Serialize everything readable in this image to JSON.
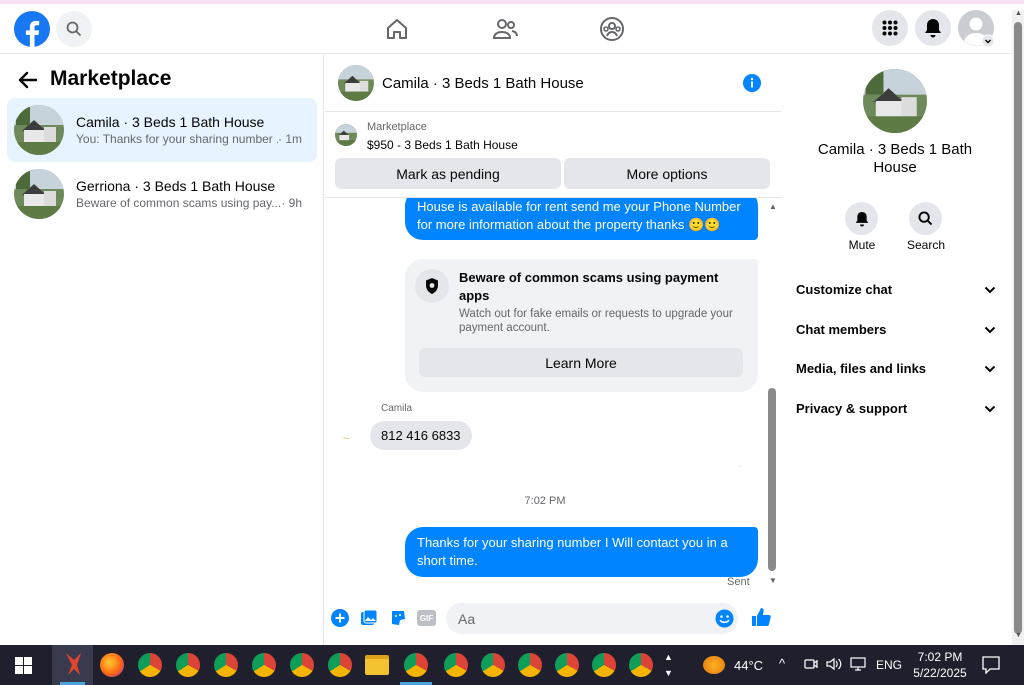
{
  "window": {
    "title": "Marketplace"
  },
  "topnav": {
    "home_icon": "home-icon",
    "friends_icon": "friends-icon",
    "groups_icon": "groups-icon"
  },
  "left": {
    "title": "Marketplace",
    "conversations": [
      {
        "name": "Camila · 3 Beds 1 Bath House",
        "preview": "You: Thanks for your sharing number ...",
        "time": "· 1m"
      },
      {
        "name": "Gerriona · 3 Beds 1 Bath House",
        "preview": "Beware of common scams using pay...",
        "time": "· 9h"
      }
    ]
  },
  "chat": {
    "header_title": "Camila · 3 Beds 1 Bath House",
    "listing_source": "Marketplace",
    "listing_price": "$950 - 3 Beds 1 Bath House",
    "mark_pending": "Mark as pending",
    "more_options": "More options",
    "msg_top": "House is available for rent send me your Phone Number for more information about the property thanks 🙂🙂",
    "scam_title": "Beware of common scams using payment apps",
    "scam_body": "Watch out for fake emails or requests to upgrade your payment account.",
    "learn_more": "Learn More",
    "sender_name": "Camila",
    "msg_phone": "812 416 6833",
    "timestamp": "7:02 PM",
    "msg_mine": "Thanks for your sharing number I Will contact you in a short time.",
    "status": "Sent",
    "composer_placeholder": "Aa"
  },
  "right": {
    "title": "Camila · 3 Beds 1 Bath House",
    "mute": "Mute",
    "search": "Search",
    "sections": [
      "Customize chat",
      "Chat members",
      "Media, files and links",
      "Privacy & support"
    ]
  },
  "taskbar": {
    "temperature": "44°C",
    "lang": "ENG",
    "time": "7:02 PM",
    "date": "5/22/2025"
  },
  "colors": {
    "accent": "#0084ff",
    "fb_blue": "#1877f2",
    "taskbar": "#1f1f2e"
  }
}
